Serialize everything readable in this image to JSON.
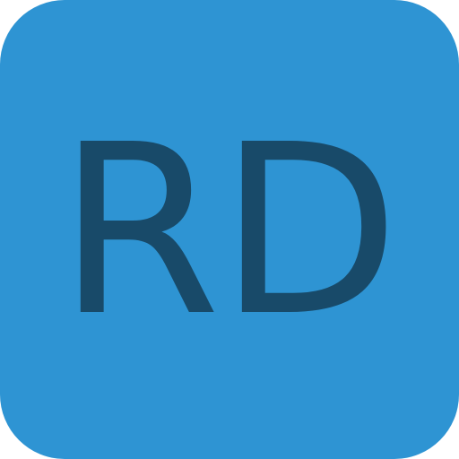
{
  "icon": {
    "monogram": "RD",
    "background_color": "#2e94d3",
    "text_color": "#184a69"
  }
}
